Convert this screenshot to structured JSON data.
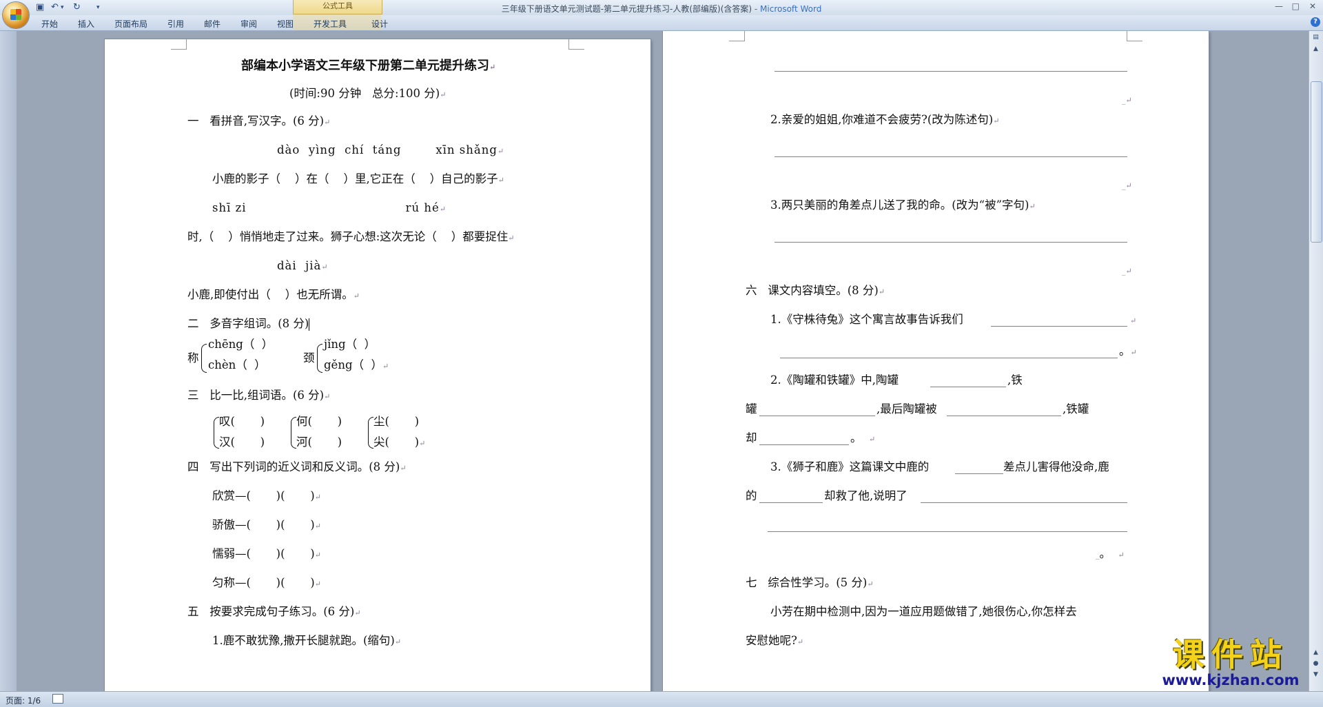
{
  "window": {
    "title": "三年级下册语文单元测试题-第二单元提升练习-人教(部编版)(含答案)",
    "app_name": " - Microsoft Word",
    "contextual_group": "公式工具",
    "controls": {
      "minimize": "—",
      "maximize": "□",
      "close": "✕"
    }
  },
  "quick_access": {
    "save_icon": "save-icon",
    "undo_icon": "undo-icon",
    "redo_icon": "redo-icon",
    "customize_icon": "dropdown-icon"
  },
  "ribbon": {
    "tabs": [
      {
        "label": "开始"
      },
      {
        "label": "插入"
      },
      {
        "label": "页面布局"
      },
      {
        "label": "引用"
      },
      {
        "label": "邮件"
      },
      {
        "label": "审阅"
      },
      {
        "label": "视图"
      },
      {
        "label": "开发工具"
      },
      {
        "label": "设计"
      }
    ],
    "help": "?"
  },
  "page1": {
    "title": "部编本小学语文三年级下册第二单元提升练习",
    "subtitle": "(时间:90 分钟   总分:100 分)",
    "q1": {
      "heading": "一   看拼音,写汉字。(6 分)",
      "pinyin1": "dào  yìng  chí  táng        xīn shǎng",
      "line1": "小鹿的影子（    ）在（    ）里,它正在（    ）自己的影子",
      "pinyin2": "shī zi                                     rú hé",
      "line2": "时,（    ）悄悄地走了过来。狮子心想:这次无论（    ）都要捉住",
      "pinyin3": "dài  jià",
      "line3": "小鹿,即使付出（    ）也无所谓。"
    },
    "q2": {
      "heading": "二   多音字组词。(8 分)",
      "char1": "称",
      "r1a": "chēng（  ）",
      "r1b": "chèn（  ）",
      "char2": "颈",
      "r2a": "jǐng（  ）",
      "r2b": "gěng（  ）"
    },
    "q3": {
      "heading": "三   比一比,组词语。(6 分)",
      "g1a": "叹(       )",
      "g1b": "汉(       )",
      "g2a": "何(       )",
      "g2b": "河(       )",
      "g3a": "尘(       )",
      "g3b": "尖(       )"
    },
    "q4": {
      "heading": "四   写出下列词的近义词和反义词。(8 分)",
      "items": [
        "欣赏—(       )(       )",
        "骄傲—(       )(       )",
        "懦弱—(       )(       )",
        "匀称—(       )(       )"
      ]
    },
    "q5": {
      "heading": "五   按要求完成句子练习。(6 分)",
      "item1": "1.鹿不敢犹豫,撒开长腿就跑。(缩句)"
    }
  },
  "page2": {
    "q5_2": "2.亲爱的姐姐,你难道不会疲劳?(改为陈述句)",
    "q5_3": "3.两只美丽的角差点儿送了我的命。(改为“被”字句)",
    "q6": {
      "heading": "六   课文内容填空。(8 分)",
      "item1": "1.《守株待兔》这个寓言故事告诉我们",
      "item1_end": "。",
      "item2_a": "2.《陶罐和铁罐》中,陶罐",
      "item2_b": ",铁",
      "item2_c": "罐",
      "item2_d": ",最后陶罐被",
      "item2_e": ",铁罐",
      "item2_f": "却",
      "item2_g": "。",
      "item3_a": "3.《狮子和鹿》这篇课文中鹿的",
      "item3_b": "差点儿害得他没命,鹿",
      "item3_c": "的",
      "item3_d": "却救了他,说明了",
      "item3_end": "。"
    },
    "q7": {
      "heading": "七   综合性学习。(5 分)",
      "text1": "小芳在期中检测中,因为一道应用题做错了,她很伤心,你怎样去",
      "text2": "安慰她呢?"
    }
  },
  "status": {
    "page": "页面: 1/6"
  },
  "watermark": {
    "name": "课件站",
    "url": "www.kjzhan.com"
  },
  "colors": {
    "blank_line": "#e33fd6",
    "ribbon": "#dfe8f5",
    "workspace": "#9aa6b6"
  }
}
